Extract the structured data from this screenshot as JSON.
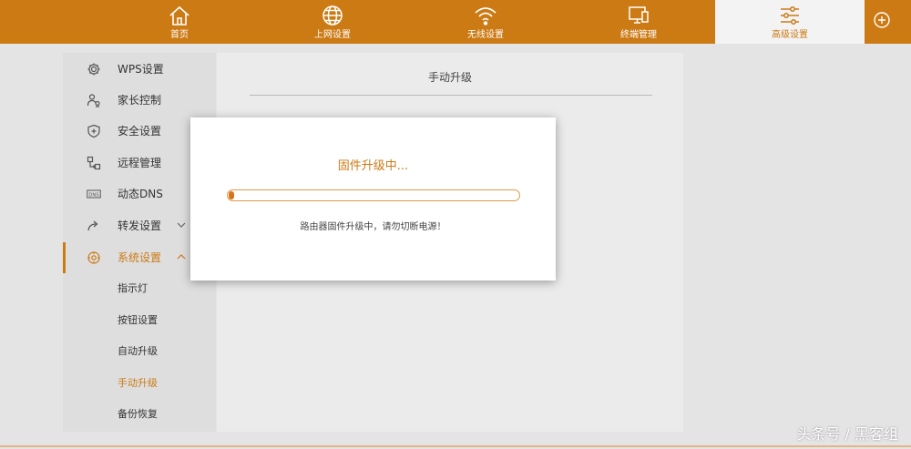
{
  "topnav": {
    "items": [
      {
        "label": "首页",
        "icon": "home-icon"
      },
      {
        "label": "上网设置",
        "icon": "globe-icon"
      },
      {
        "label": "无线设置",
        "icon": "wifi-icon"
      },
      {
        "label": "终端管理",
        "icon": "devices-icon"
      },
      {
        "label": "高级设置",
        "icon": "sliders-icon"
      }
    ],
    "active_color": "#cc7a14"
  },
  "sidebar": {
    "items": [
      {
        "label": "WPS设置",
        "icon": "gear-icon"
      },
      {
        "label": "家长控制",
        "icon": "parent-icon"
      },
      {
        "label": "安全设置",
        "icon": "shield-icon"
      },
      {
        "label": "远程管理",
        "icon": "remote-icon"
      },
      {
        "label": "动态DNS",
        "icon": "dns-icon"
      },
      {
        "label": "转发设置",
        "icon": "forward-icon"
      },
      {
        "label": "系统设置",
        "icon": "system-icon"
      }
    ],
    "subitems": [
      {
        "label": "指示灯"
      },
      {
        "label": "按钮设置"
      },
      {
        "label": "自动升级"
      },
      {
        "label": "手动升级"
      },
      {
        "label": "备份恢复"
      }
    ]
  },
  "main": {
    "title": "手动升级"
  },
  "modal": {
    "title": "固件升级中...",
    "progress": 0.02,
    "message": "路由器固件升级中，请勿切断电源！"
  },
  "watermark": "头条号 / 黑客组"
}
